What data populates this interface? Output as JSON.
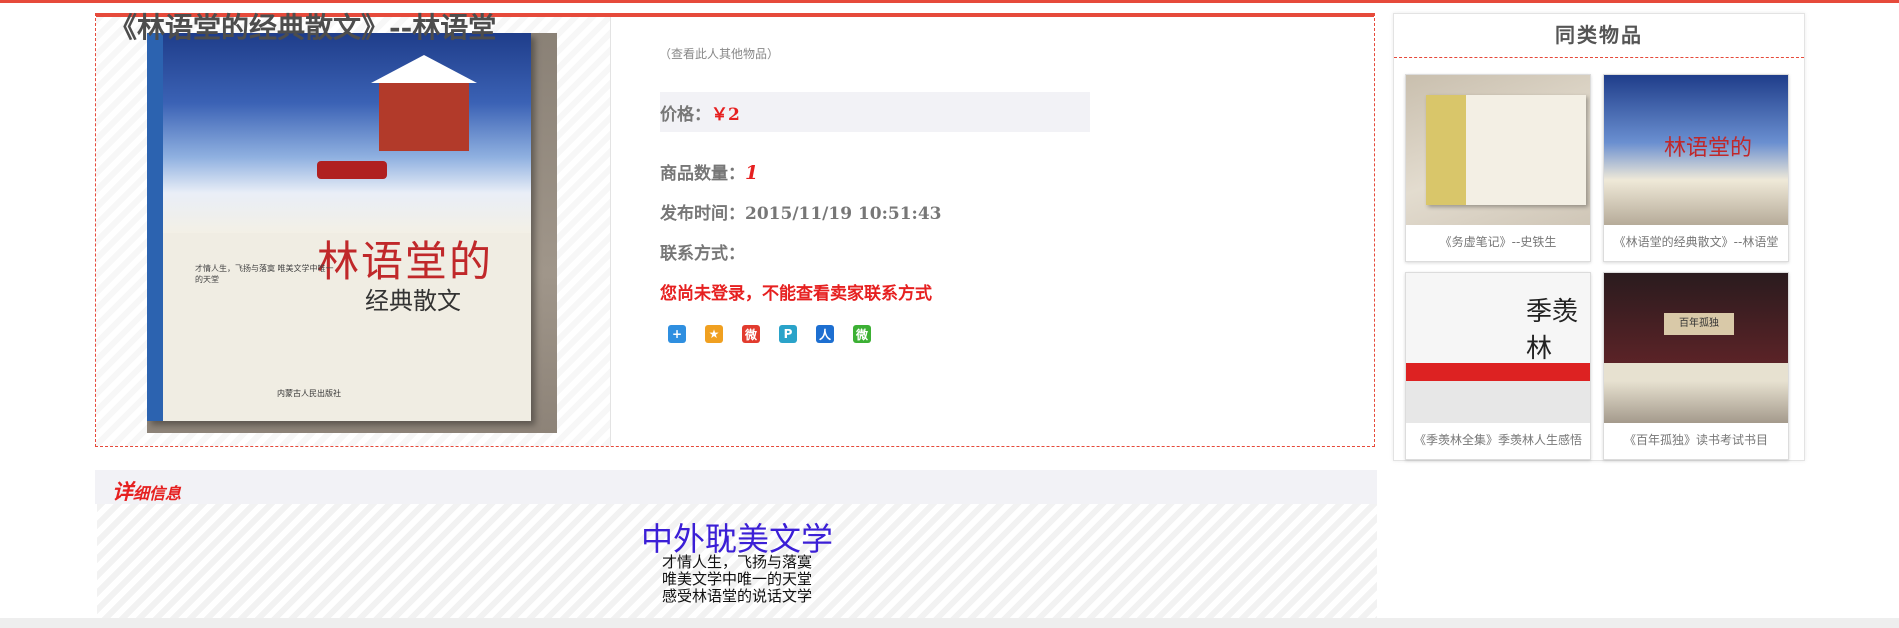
{
  "product": {
    "title": "《林语堂的经典散文》--林语堂",
    "seller_link": "（查看此人其他物品）",
    "price_label": "价格：",
    "price_value": "￥2",
    "quantity_label": "商品数量：",
    "quantity_value": "1",
    "publish_label": "发布时间：",
    "publish_value": "2015/11/19 10:51:43",
    "contact_label": "联系方式：",
    "login_notice": "您尚未登录，不能查看卖家联系方式",
    "photo": {
      "cover_title": "林语堂的",
      "cover_subtitle": "经典散文",
      "cover_blurb": "才情人生，飞扬与落寞 唯美文学中唯一的天堂",
      "publisher": "内蒙古人民出版社"
    },
    "share_icons": [
      {
        "name": "qzone-share-icon",
        "glyph": "+",
        "color": "#2f8fe0"
      },
      {
        "name": "favorite-share-icon",
        "glyph": "★",
        "color": "#f0a020"
      },
      {
        "name": "weibo-share-icon",
        "glyph": "微",
        "color": "#e23b2e"
      },
      {
        "name": "pinterest-share-icon",
        "glyph": "P",
        "color": "#2aa3c9"
      },
      {
        "name": "renren-share-icon",
        "glyph": "人",
        "color": "#1d6fd1"
      },
      {
        "name": "wechat-share-icon",
        "glyph": "微",
        "color": "#3cb034"
      }
    ]
  },
  "sidebar": {
    "title": "同类物品",
    "items": [
      {
        "caption": "《务虚笔记》--史铁生",
        "thumb_text": ""
      },
      {
        "caption": "《林语堂的经典散文》--林语堂",
        "thumb_text": "林语堂的"
      },
      {
        "caption": "《季羡林全集》季羡林人生感悟",
        "thumb_text": "季羡林"
      },
      {
        "caption": "《百年孤独》读书考试书目",
        "thumb_text": "百年孤独"
      }
    ]
  },
  "detail": {
    "header_big": "详",
    "header_rest": "细信息",
    "heading": "中外耽美文学",
    "lines": [
      "才情人生，飞扬与落寞",
      "唯美文学中唯一的天堂",
      "感受林语堂的说话文学"
    ]
  }
}
